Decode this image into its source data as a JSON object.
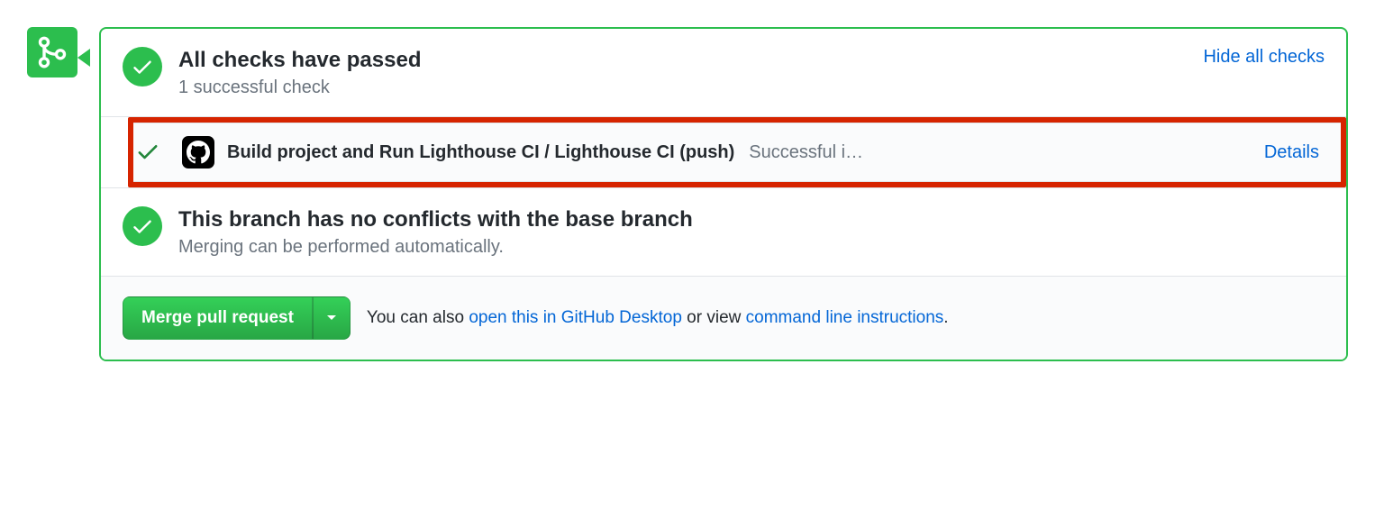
{
  "checks": {
    "title": "All checks have passed",
    "subtitle": "1 successful check",
    "toggle_label": "Hide all checks",
    "items": [
      {
        "name": "Build project and Run Lighthouse CI / Lighthouse CI (push)",
        "status": "Successful i…",
        "details_label": "Details"
      }
    ]
  },
  "conflicts": {
    "title": "This branch has no conflicts with the base branch",
    "subtitle": "Merging can be performed automatically."
  },
  "merge": {
    "button_label": "Merge pull request",
    "text_before": "You can also ",
    "link_desktop": "open this in GitHub Desktop",
    "text_mid": " or view ",
    "link_cli": "command line instructions",
    "text_after": "."
  }
}
